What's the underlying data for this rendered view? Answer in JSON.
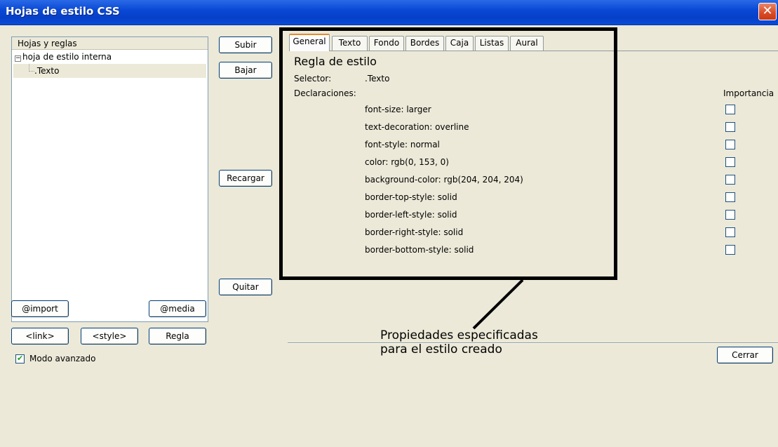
{
  "window": {
    "title": "Hojas de estilo CSS",
    "close_symbol": "✕"
  },
  "tree": {
    "header": "Hojas y reglas",
    "root_expander": "−",
    "root_label": "hoja de estilo interna",
    "child_label": ".Texto"
  },
  "left_buttons": {
    "import": "@import",
    "media": "@media",
    "link": "<link>",
    "style": "<style>",
    "regla": "Regla"
  },
  "advanced_mode": {
    "label": "Modo avanzado",
    "checked": true
  },
  "middle_buttons": {
    "subir": "Subir",
    "bajar": "Bajar",
    "recargar": "Recargar",
    "quitar": "Quitar"
  },
  "tabs": [
    "General",
    "Texto",
    "Fondo",
    "Bordes",
    "Caja",
    "Listas",
    "Aural"
  ],
  "active_tab": "General",
  "rule": {
    "heading": "Regla de estilo",
    "selector_label": "Selector:",
    "selector_value": ".Texto",
    "declarations_label": "Declaraciones:",
    "importance_label": "Importancia",
    "declarations": [
      "font-size: larger",
      "text-decoration: overline",
      "font-style: normal",
      "color: rgb(0, 153, 0)",
      "background-color: rgb(204, 204, 204)",
      "border-top-style: solid",
      "border-left-style: solid",
      "border-right-style: solid",
      "border-bottom-style: solid"
    ]
  },
  "close_button": "Cerrar",
  "annotation": {
    "line1": "Propiedades especificadas",
    "line2": "para el estilo creado"
  }
}
